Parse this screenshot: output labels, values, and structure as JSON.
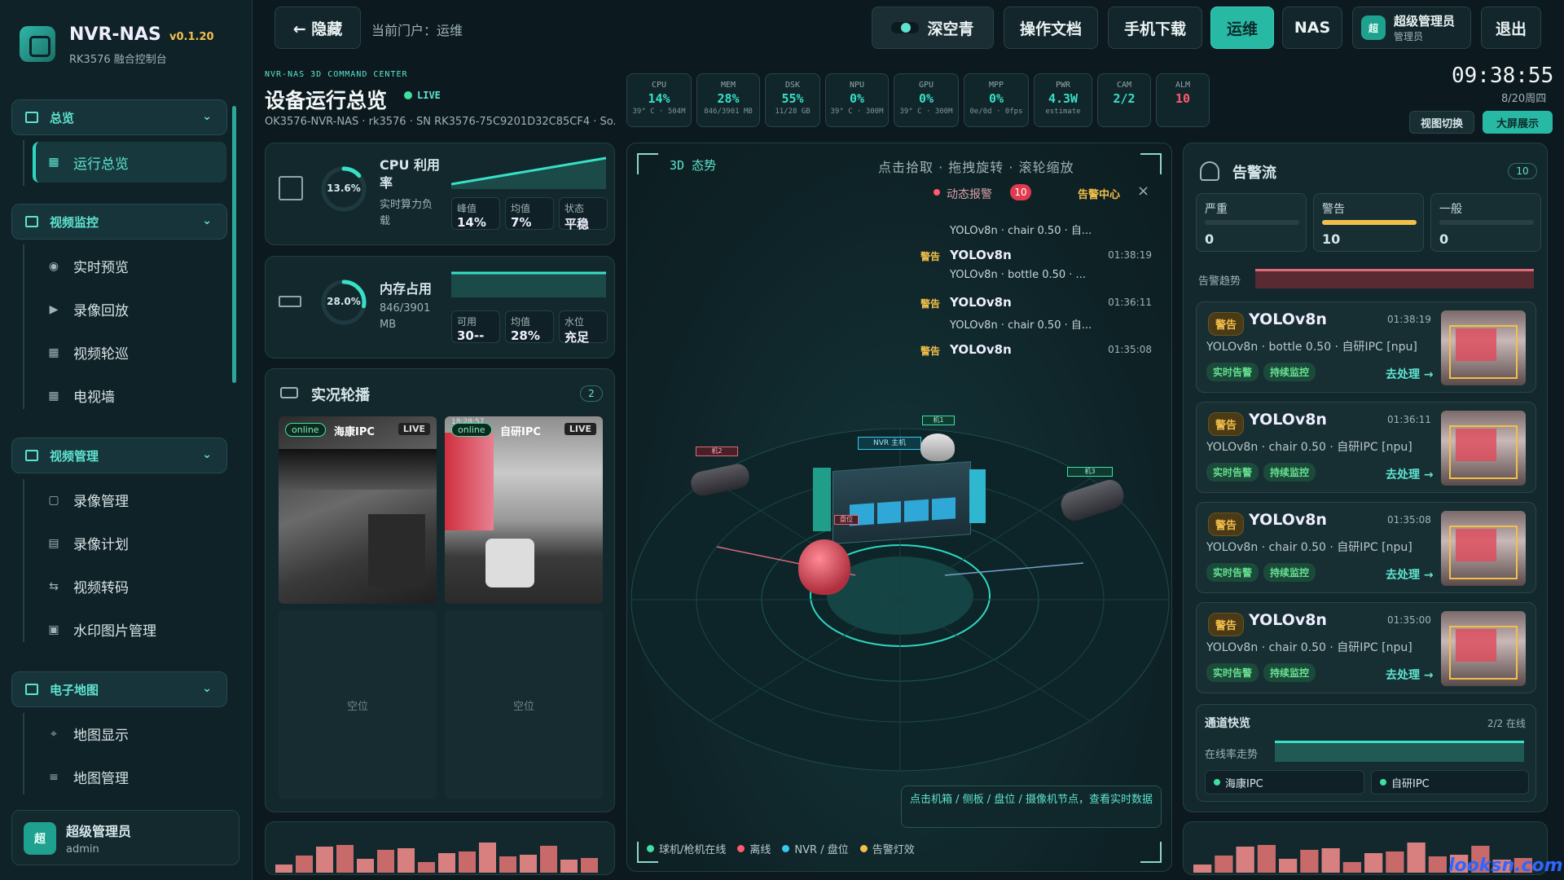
{
  "app": {
    "name": "NVR-NAS",
    "version": "v0.1.20",
    "subtitle": "RK3576 融合控制台"
  },
  "sidebar": {
    "groups": [
      {
        "label": "总览",
        "items": [
          {
            "label": "运行总览"
          }
        ]
      },
      {
        "label": "视频监控",
        "items": [
          {
            "label": "实时预览"
          },
          {
            "label": "录像回放"
          },
          {
            "label": "视频轮巡"
          },
          {
            "label": "电视墙"
          }
        ]
      },
      {
        "label": "视频管理",
        "items": [
          {
            "label": "录像管理"
          },
          {
            "label": "录像计划"
          },
          {
            "label": "视频转码"
          },
          {
            "label": "水印图片管理"
          }
        ]
      },
      {
        "label": "电子地图",
        "items": [
          {
            "label": "地图显示"
          },
          {
            "label": "地图管理"
          }
        ]
      }
    ],
    "user": {
      "avatar": "超",
      "name": "超级管理员",
      "role": "admin"
    }
  },
  "topbar": {
    "hide": "← 隐藏",
    "portal": "当前门户：运维",
    "theme": "深空青",
    "docs": "操作文档",
    "mobile": "手机下载",
    "ops": "运维",
    "nas": "NAS",
    "user_avatar": "超",
    "user_name": "超级管理员",
    "user_role": "管理员",
    "logout": "退出"
  },
  "header": {
    "kicker": "NVR-NAS 3D COMMAND CENTER",
    "title": "设备运行总览",
    "live": "LIVE",
    "device": "OK3576-NVR-NAS · rk3576 · SN RK3576-75C9201D32C85CF4 · So..."
  },
  "metrics": [
    {
      "label": "CPU",
      "value": "14%",
      "sub": "39° C · 504M",
      "color": "#37e0c6"
    },
    {
      "label": "MEM",
      "value": "28%",
      "sub": "846/3901 MB",
      "color": "#37e0c6"
    },
    {
      "label": "DSK",
      "value": "55%",
      "sub": "11/28 GB",
      "color": "#37e0c6"
    },
    {
      "label": "NPU",
      "value": "0%",
      "sub": "39° C · 300M",
      "color": "#37e0c6"
    },
    {
      "label": "GPU",
      "value": "0%",
      "sub": "39° C · 300M",
      "color": "#37e0c6"
    },
    {
      "label": "MPP",
      "value": "0%",
      "sub": "0e/0d · 0fps",
      "color": "#37e0c6"
    },
    {
      "label": "PWR",
      "value": "4.3W",
      "sub": "estimate",
      "color": "#37e0c6"
    },
    {
      "label": "CAM",
      "value": "2/2",
      "sub": "",
      "color": "#37e0c6"
    },
    {
      "label": "ALM",
      "value": "10",
      "sub": "",
      "color": "#ff5a6e"
    }
  ],
  "clock": {
    "time": "09:38:55",
    "date": "8/20周四",
    "view_switch": "视图切换",
    "bigscreen": "大屏展示"
  },
  "cpu": {
    "percent": "13.6%",
    "pct_value": 13.6,
    "title": "CPU 利用率",
    "desc": "实时算力负载",
    "peak_label": "峰值",
    "peak": "14%",
    "avg_label": "均值",
    "avg": "7%",
    "state_label": "状态",
    "state": "平稳"
  },
  "mem": {
    "percent": "28.0%",
    "pct_value": 28.0,
    "title": "内存占用",
    "desc": "846/3901 MB",
    "avail_label": "可用",
    "avail": "30--",
    "avg_label": "均值",
    "avg": "28%",
    "level_label": "水位",
    "level": "充足"
  },
  "live": {
    "title": "实况轮播",
    "count": "2",
    "cams": [
      {
        "status": "online",
        "name": "海康IPC",
        "badge": "LIVE"
      },
      {
        "status": "online",
        "name": "自研IPC",
        "badge": "LIVE",
        "ts": "18:28:57"
      }
    ],
    "empty": "空位"
  },
  "center": {
    "title": "3D 态势",
    "hints": [
      "点击拾取",
      "拖拽旋转",
      "滚轮缩放"
    ],
    "dynamic_alarm": "动态报警",
    "alarm_count": "10",
    "alarm_center": "告警中心",
    "close": "×",
    "feed": [
      {
        "level": "",
        "name": "",
        "time": "",
        "desc": "YOLOv8n · chair 0.50 · 自..."
      },
      {
        "level": "警告",
        "name": "YOLOv8n",
        "time": "01:38:19",
        "desc": "YOLOv8n · bottle 0.50 · ..."
      },
      {
        "level": "警告",
        "name": "YOLOv8n",
        "time": "01:36:11",
        "desc": "YOLOv8n · chair 0.50 · 自..."
      },
      {
        "level": "警告",
        "name": "YOLOv8n",
        "time": "01:35:08",
        "desc": ""
      }
    ],
    "labels": {
      "nvr": "NVR 主机",
      "cam_a": "机1",
      "cam_b": "机2",
      "cam_c": "机3",
      "disk": "盘位"
    },
    "tip": "点击机箱 / 侧板 / 盘位 / 摄像机节点，查看实时数据",
    "legend": [
      {
        "label": "球机/枪机在线",
        "color": "#3fe0a0"
      },
      {
        "label": "离线",
        "color": "#ff5a6e"
      },
      {
        "label": "NVR / 盘位",
        "color": "#37c8f0"
      },
      {
        "label": "告警灯效",
        "color": "#f2c04a"
      }
    ]
  },
  "alarms": {
    "title": "告警流",
    "count": "10",
    "levels": [
      {
        "label": "严重",
        "value": "0",
        "fill": 0,
        "color": "#ff5a6e"
      },
      {
        "label": "警告",
        "value": "10",
        "fill": 1,
        "color": "#f2c04a"
      },
      {
        "label": "一般",
        "value": "0",
        "fill": 0,
        "color": "#37c8f0"
      }
    ],
    "trend_label": "告警趋势",
    "cards": [
      {
        "level": "警告",
        "name": "YOLOv8n",
        "time": "01:38:19",
        "desc": "YOLOv8n · bottle 0.50 · 自研IPC [npu]",
        "tag1": "实时告警",
        "tag2": "持续监控",
        "action": "去处理 →"
      },
      {
        "level": "警告",
        "name": "YOLOv8n",
        "time": "01:36:11",
        "desc": "YOLOv8n · chair 0.50 · 自研IPC [npu]",
        "tag1": "实时告警",
        "tag2": "持续监控",
        "action": "去处理 →"
      },
      {
        "level": "警告",
        "name": "YOLOv8n",
        "time": "01:35:08",
        "desc": "YOLOv8n · chair 0.50 · 自研IPC [npu]",
        "tag1": "实时告警",
        "tag2": "持续监控",
        "action": "去处理 →"
      },
      {
        "level": "警告",
        "name": "YOLOv8n",
        "time": "01:35:00",
        "desc": "YOLOv8n · chair 0.50 · 自研IPC [npu]",
        "tag1": "实时告警",
        "tag2": "持续监控",
        "action": "去处理 →"
      }
    ]
  },
  "channels": {
    "title": "通道快览",
    "online": "2/2 在线",
    "trend": "在线率走势",
    "items": [
      "海康IPC",
      "自研IPC"
    ]
  },
  "watermark": "looksn.com"
}
